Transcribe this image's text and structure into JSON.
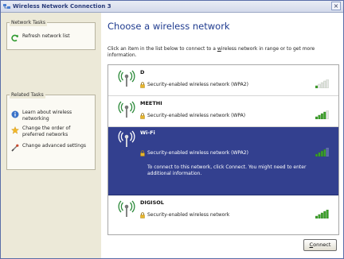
{
  "window": {
    "title": "Wireless Network Connection 3",
    "close_glyph": "×"
  },
  "left": {
    "network_tasks": {
      "title": "Network Tasks",
      "items": [
        {
          "label": "Refresh network list",
          "icon": "refresh-icon"
        }
      ]
    },
    "related_tasks": {
      "title": "Related Tasks",
      "items": [
        {
          "label": "Learn about wireless networking",
          "icon": "info-icon"
        },
        {
          "label": "Change the order of preferred networks",
          "icon": "star-icon"
        },
        {
          "label": "Change advanced settings",
          "icon": "settings-icon"
        }
      ]
    }
  },
  "main": {
    "heading": "Choose a wireless network",
    "instruction_pre": "Click an item in the list below to connect to a ",
    "instruction_link": "w",
    "instruction_post": "ireless network in range or to get more information.",
    "networks": [
      {
        "ssid": "D",
        "security": "Security-enabled wireless network (WPA2)",
        "signal_bars": 1,
        "selected": false
      },
      {
        "ssid": "MEETHI",
        "security": "Security-enabled wireless network (WPA)",
        "signal_bars": 4,
        "selected": false
      },
      {
        "ssid": "Wi-Fi",
        "security": "Security-enabled wireless network (WPA2)",
        "signal_bars": 4,
        "selected": true,
        "message": "To connect to this network, click Connect. You might need to enter additional information."
      },
      {
        "ssid": "DIGISOL",
        "security": "Security-enabled wireless network",
        "signal_bars": 5,
        "selected": false
      }
    ],
    "connect_underline": "C",
    "connect_rest": "onnect"
  },
  "colors": {
    "selection": "#33408f",
    "bars": "#3da22a",
    "heading": "#1f3b8f"
  }
}
